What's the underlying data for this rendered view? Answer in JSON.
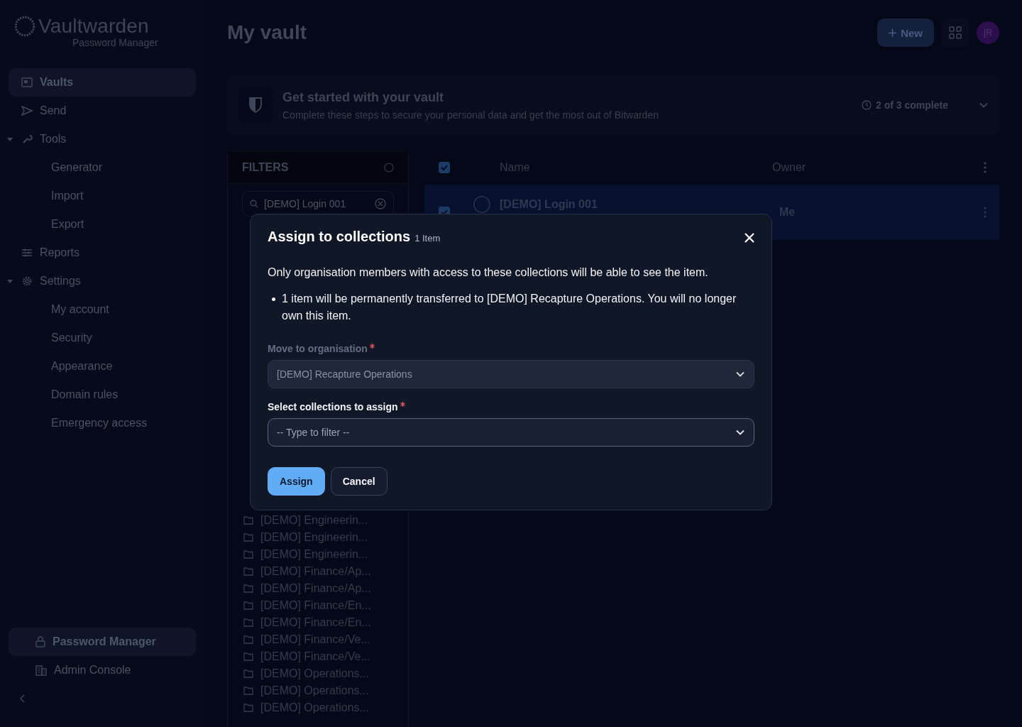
{
  "logo": {
    "wordmark": "Vaultwarden",
    "subtitle": "Password Manager"
  },
  "nav": [
    {
      "label": "Vaults",
      "selected": true
    },
    {
      "label": "Send",
      "selected": false
    },
    {
      "label": "Tools",
      "selected": false,
      "expanded": true,
      "children": [
        {
          "label": "Generator",
          "selected": false
        },
        {
          "label": "Import",
          "selected": false
        },
        {
          "label": "Export",
          "selected": false
        }
      ]
    },
    {
      "label": "Reports",
      "selected": false
    },
    {
      "label": "Settings",
      "selected": false,
      "expanded": true,
      "children": [
        {
          "label": "My account",
          "selected": false
        },
        {
          "label": "Security",
          "selected": false
        },
        {
          "label": "Appearance",
          "selected": false
        },
        {
          "label": "Domain rules",
          "selected": false
        },
        {
          "label": "Emergency access",
          "selected": false
        }
      ]
    }
  ],
  "product_switcher": [
    {
      "label": "Password Manager",
      "selected": true
    },
    {
      "label": "Admin Console",
      "selected": false
    }
  ],
  "page_title": "My vault",
  "new_button": "New",
  "avatar": "[R",
  "banner": {
    "title": "Get started with your vault",
    "subtitle": "Complete these steps to secure your personal data and get the most out of Bitwarden",
    "progress": "2 of 3 complete"
  },
  "filters": {
    "title": "FILTERS",
    "search_value": "[DEMO] Login 001",
    "collections": [
      "[DEMO] Engineerin...",
      "[DEMO] Engineerin...",
      "[DEMO] Engineerin...",
      "[DEMO] Finance/Ap...",
      "[DEMO] Finance/Ap...",
      "[DEMO] Finance/En...",
      "[DEMO] Finance/En...",
      "[DEMO] Finance/Ve...",
      "[DEMO] Finance/Ve...",
      "[DEMO] Operations...",
      "[DEMO] Operations...",
      "[DEMO] Operations..."
    ]
  },
  "table": {
    "all_checked": true,
    "columns": [
      "Name",
      "Owner"
    ],
    "rows": [
      {
        "name": "[DEMO] Login 001",
        "owner": "Me",
        "checked": true,
        "selected": true
      }
    ]
  },
  "dialog": {
    "title": "Assign to collections",
    "count": "1 Item",
    "description": "Only organisation members with access to these collections will be able to see the item.",
    "bullets": [
      "1 item will be permanently transferred to [DEMO] Recapture Operations. You will no longer own this item."
    ],
    "fields": [
      {
        "label": "Move to organisation",
        "required": true,
        "value": "[DEMO] Recapture Operations",
        "disabled": true
      },
      {
        "label": "Select collections to assign",
        "required": true,
        "placeholder": "-- Type to filter --",
        "disabled": false
      }
    ],
    "buttons": [
      {
        "label": "Assign",
        "kind": "primary"
      },
      {
        "label": "Cancel",
        "kind": "secondary"
      }
    ]
  }
}
